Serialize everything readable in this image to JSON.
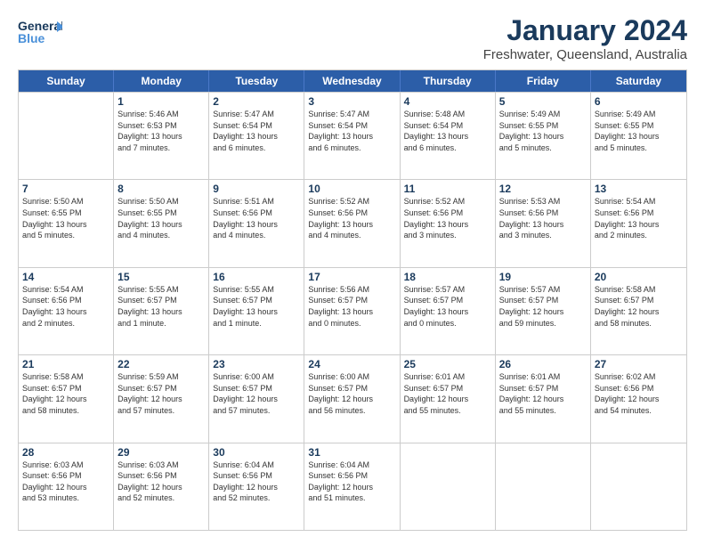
{
  "logo": {
    "line1": "General",
    "line2": "Blue",
    "icon": "▶"
  },
  "title": "January 2024",
  "location": "Freshwater, Queensland, Australia",
  "header_days": [
    "Sunday",
    "Monday",
    "Tuesday",
    "Wednesday",
    "Thursday",
    "Friday",
    "Saturday"
  ],
  "weeks": [
    [
      {
        "day": "",
        "info": ""
      },
      {
        "day": "1",
        "info": "Sunrise: 5:46 AM\nSunset: 6:53 PM\nDaylight: 13 hours\nand 7 minutes."
      },
      {
        "day": "2",
        "info": "Sunrise: 5:47 AM\nSunset: 6:54 PM\nDaylight: 13 hours\nand 6 minutes."
      },
      {
        "day": "3",
        "info": "Sunrise: 5:47 AM\nSunset: 6:54 PM\nDaylight: 13 hours\nand 6 minutes."
      },
      {
        "day": "4",
        "info": "Sunrise: 5:48 AM\nSunset: 6:54 PM\nDaylight: 13 hours\nand 6 minutes."
      },
      {
        "day": "5",
        "info": "Sunrise: 5:49 AM\nSunset: 6:55 PM\nDaylight: 13 hours\nand 5 minutes."
      },
      {
        "day": "6",
        "info": "Sunrise: 5:49 AM\nSunset: 6:55 PM\nDaylight: 13 hours\nand 5 minutes."
      }
    ],
    [
      {
        "day": "7",
        "info": "Sunrise: 5:50 AM\nSunset: 6:55 PM\nDaylight: 13 hours\nand 5 minutes."
      },
      {
        "day": "8",
        "info": "Sunrise: 5:50 AM\nSunset: 6:55 PM\nDaylight: 13 hours\nand 4 minutes."
      },
      {
        "day": "9",
        "info": "Sunrise: 5:51 AM\nSunset: 6:56 PM\nDaylight: 13 hours\nand 4 minutes."
      },
      {
        "day": "10",
        "info": "Sunrise: 5:52 AM\nSunset: 6:56 PM\nDaylight: 13 hours\nand 4 minutes."
      },
      {
        "day": "11",
        "info": "Sunrise: 5:52 AM\nSunset: 6:56 PM\nDaylight: 13 hours\nand 3 minutes."
      },
      {
        "day": "12",
        "info": "Sunrise: 5:53 AM\nSunset: 6:56 PM\nDaylight: 13 hours\nand 3 minutes."
      },
      {
        "day": "13",
        "info": "Sunrise: 5:54 AM\nSunset: 6:56 PM\nDaylight: 13 hours\nand 2 minutes."
      }
    ],
    [
      {
        "day": "14",
        "info": "Sunrise: 5:54 AM\nSunset: 6:56 PM\nDaylight: 13 hours\nand 2 minutes."
      },
      {
        "day": "15",
        "info": "Sunrise: 5:55 AM\nSunset: 6:57 PM\nDaylight: 13 hours\nand 1 minute."
      },
      {
        "day": "16",
        "info": "Sunrise: 5:55 AM\nSunset: 6:57 PM\nDaylight: 13 hours\nand 1 minute."
      },
      {
        "day": "17",
        "info": "Sunrise: 5:56 AM\nSunset: 6:57 PM\nDaylight: 13 hours\nand 0 minutes."
      },
      {
        "day": "18",
        "info": "Sunrise: 5:57 AM\nSunset: 6:57 PM\nDaylight: 13 hours\nand 0 minutes."
      },
      {
        "day": "19",
        "info": "Sunrise: 5:57 AM\nSunset: 6:57 PM\nDaylight: 12 hours\nand 59 minutes."
      },
      {
        "day": "20",
        "info": "Sunrise: 5:58 AM\nSunset: 6:57 PM\nDaylight: 12 hours\nand 58 minutes."
      }
    ],
    [
      {
        "day": "21",
        "info": "Sunrise: 5:58 AM\nSunset: 6:57 PM\nDaylight: 12 hours\nand 58 minutes."
      },
      {
        "day": "22",
        "info": "Sunrise: 5:59 AM\nSunset: 6:57 PM\nDaylight: 12 hours\nand 57 minutes."
      },
      {
        "day": "23",
        "info": "Sunrise: 6:00 AM\nSunset: 6:57 PM\nDaylight: 12 hours\nand 57 minutes."
      },
      {
        "day": "24",
        "info": "Sunrise: 6:00 AM\nSunset: 6:57 PM\nDaylight: 12 hours\nand 56 minutes."
      },
      {
        "day": "25",
        "info": "Sunrise: 6:01 AM\nSunset: 6:57 PM\nDaylight: 12 hours\nand 55 minutes."
      },
      {
        "day": "26",
        "info": "Sunrise: 6:01 AM\nSunset: 6:57 PM\nDaylight: 12 hours\nand 55 minutes."
      },
      {
        "day": "27",
        "info": "Sunrise: 6:02 AM\nSunset: 6:56 PM\nDaylight: 12 hours\nand 54 minutes."
      }
    ],
    [
      {
        "day": "28",
        "info": "Sunrise: 6:03 AM\nSunset: 6:56 PM\nDaylight: 12 hours\nand 53 minutes."
      },
      {
        "day": "29",
        "info": "Sunrise: 6:03 AM\nSunset: 6:56 PM\nDaylight: 12 hours\nand 52 minutes."
      },
      {
        "day": "30",
        "info": "Sunrise: 6:04 AM\nSunset: 6:56 PM\nDaylight: 12 hours\nand 52 minutes."
      },
      {
        "day": "31",
        "info": "Sunrise: 6:04 AM\nSunset: 6:56 PM\nDaylight: 12 hours\nand 51 minutes."
      },
      {
        "day": "",
        "info": ""
      },
      {
        "day": "",
        "info": ""
      },
      {
        "day": "",
        "info": ""
      }
    ]
  ]
}
